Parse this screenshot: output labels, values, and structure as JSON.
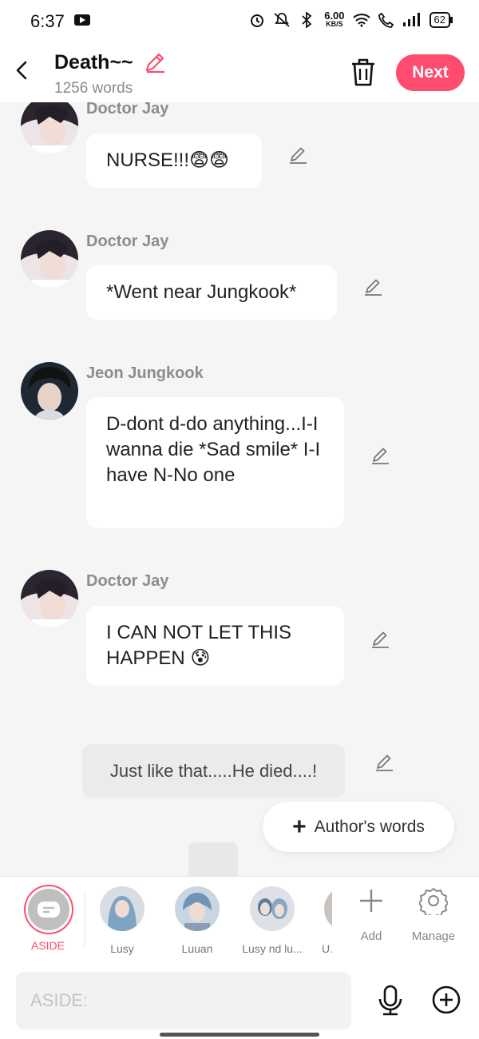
{
  "status": {
    "time": "6:37",
    "net_speed": "6.00",
    "net_unit": "KB/S",
    "battery": "62"
  },
  "header": {
    "title": "Death~~",
    "word_count": "1256 words",
    "next_label": "Next"
  },
  "messages": [
    {
      "sender": "Doctor Jay",
      "text": "NURSE!!!😨😨"
    },
    {
      "sender": "Doctor Jay",
      "text": "*Went near Jungkook*"
    },
    {
      "sender": "Jeon Jungkook",
      "text": "D-dont d-do anything...I-I wanna die *Sad smile* I-I have N-No one"
    },
    {
      "sender": "Doctor Jay",
      "text": "I CAN NOT LET THIS HAPPEN 😰"
    }
  ],
  "aside_text": "Just like that.....He died....!",
  "authors_words_label": "Author's words",
  "characters": {
    "aside_label": "ASIDE",
    "items": [
      {
        "label": "Lusy"
      },
      {
        "label": "Luuan"
      },
      {
        "label": "Lusy nd lu..."
      },
      {
        "label": "Ur"
      }
    ],
    "add_label": "Add",
    "manage_label": "Manage"
  },
  "input": {
    "placeholder": "ASIDE:"
  },
  "colors": {
    "accent": "#ff4b6e",
    "background": "#f5f5f5"
  }
}
